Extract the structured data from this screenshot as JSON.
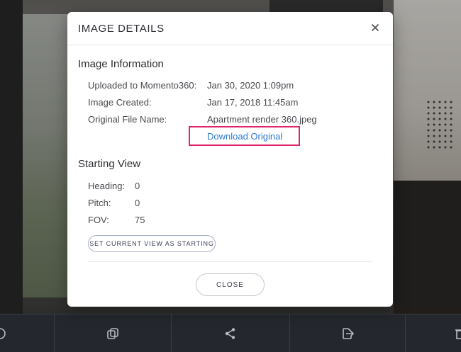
{
  "modal": {
    "title": "IMAGE DETAILS",
    "image_information": {
      "heading": "Image Information",
      "rows": [
        {
          "label": "Uploaded to Momento360:",
          "value": "Jan 30, 2020 1:09pm"
        },
        {
          "label": "Image Created:",
          "value": "Jan 17, 2018 11:45am"
        },
        {
          "label": "Original File Name:",
          "value": "Apartment render 360.jpeg"
        }
      ],
      "download_label": "Download Original"
    },
    "starting_view": {
      "heading": "Starting View",
      "rows": [
        {
          "label": "Heading:",
          "value": "0"
        },
        {
          "label": "Pitch:",
          "value": "0"
        },
        {
          "label": "FOV:",
          "value": "75"
        }
      ],
      "set_button_label": "SET CURRENT VIEW AS STARTING"
    },
    "close_label": "CLOSE",
    "highlight_color": "#e0256c",
    "link_color": "#2f7bd6"
  },
  "toolbar": {
    "icons": [
      "partial-icon",
      "copy-icon",
      "share-icon",
      "export-icon",
      "trash-icon"
    ]
  }
}
